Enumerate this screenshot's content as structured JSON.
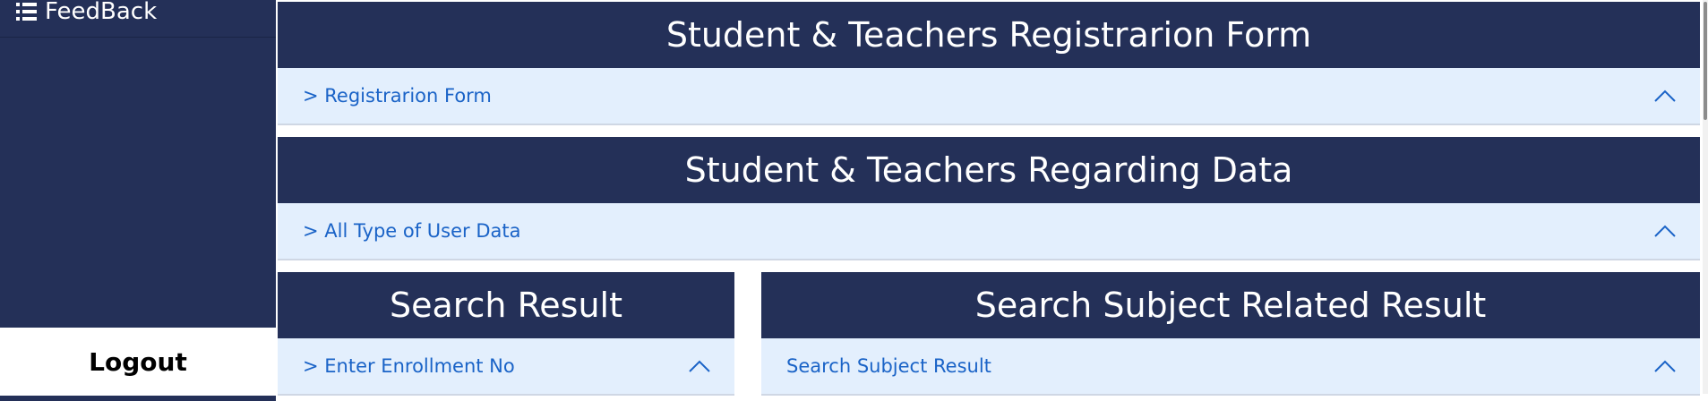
{
  "sidebar": {
    "feedback_label": "FeedBack",
    "logout_label": "Logout"
  },
  "panels": {
    "registration": {
      "title": "Student & Teachers Registrarion Form",
      "link": "> Registrarion Form"
    },
    "regarding_data": {
      "title": "Student & Teachers Regarding Data",
      "link": "> All Type of User Data"
    },
    "search_result": {
      "title": "Search Result",
      "link": "> Enter Enrollment No"
    },
    "subject_result": {
      "title": "Search Subject Related Result",
      "link": "Search Subject Result"
    }
  },
  "icons": {
    "feedback": "list-icon",
    "collapse": "chevron-up-icon"
  },
  "colors": {
    "navy": "#243058",
    "light_blue": "#e3effd",
    "link_blue": "#1a63c7"
  }
}
